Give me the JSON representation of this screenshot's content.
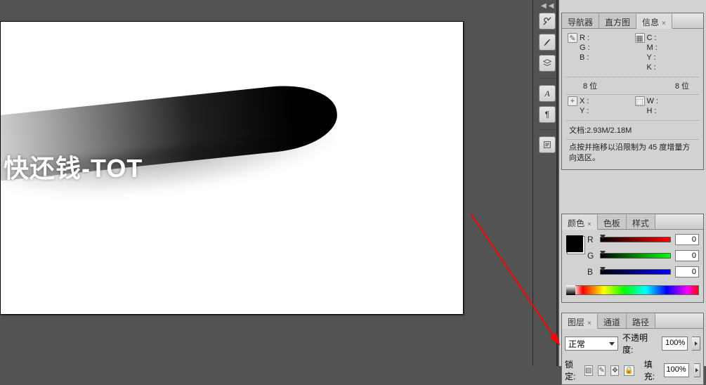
{
  "canvas": {
    "watermark": "快还钱-TOT"
  },
  "info_panel": {
    "tabs": [
      "导航器",
      "直方图",
      "信息"
    ],
    "active_tab": 2,
    "rgb": {
      "R": "R :",
      "G": "G :",
      "B": "B :"
    },
    "cmyk": {
      "C": "C :",
      "M": "M :",
      "Y": "Y :",
      "K": "K :"
    },
    "bit_left": "8 位",
    "bit_right": "8 位",
    "xy": {
      "X": "X :",
      "Y": "Y :"
    },
    "wh": {
      "W": "W :",
      "H": "H :"
    },
    "doc": "文档:2.93M/2.18M",
    "hint": "点按并拖移以沿限制为 45 度增量方向选区。"
  },
  "color_panel": {
    "tabs": [
      "颜色",
      "色板",
      "样式"
    ],
    "active_tab": 0,
    "channels": [
      {
        "label": "R",
        "value": "0"
      },
      {
        "label": "G",
        "value": "0"
      },
      {
        "label": "B",
        "value": "0"
      }
    ]
  },
  "layers_panel": {
    "tabs": [
      "图层",
      "通道",
      "路径"
    ],
    "active_tab": 0,
    "blend_mode": "正常",
    "opacity_label": "不透明度:",
    "opacity_value": "100%",
    "lock_label": "锁定:",
    "fill_label": "填充:",
    "fill_value": "100%"
  },
  "collapse_hint": "◀◀"
}
